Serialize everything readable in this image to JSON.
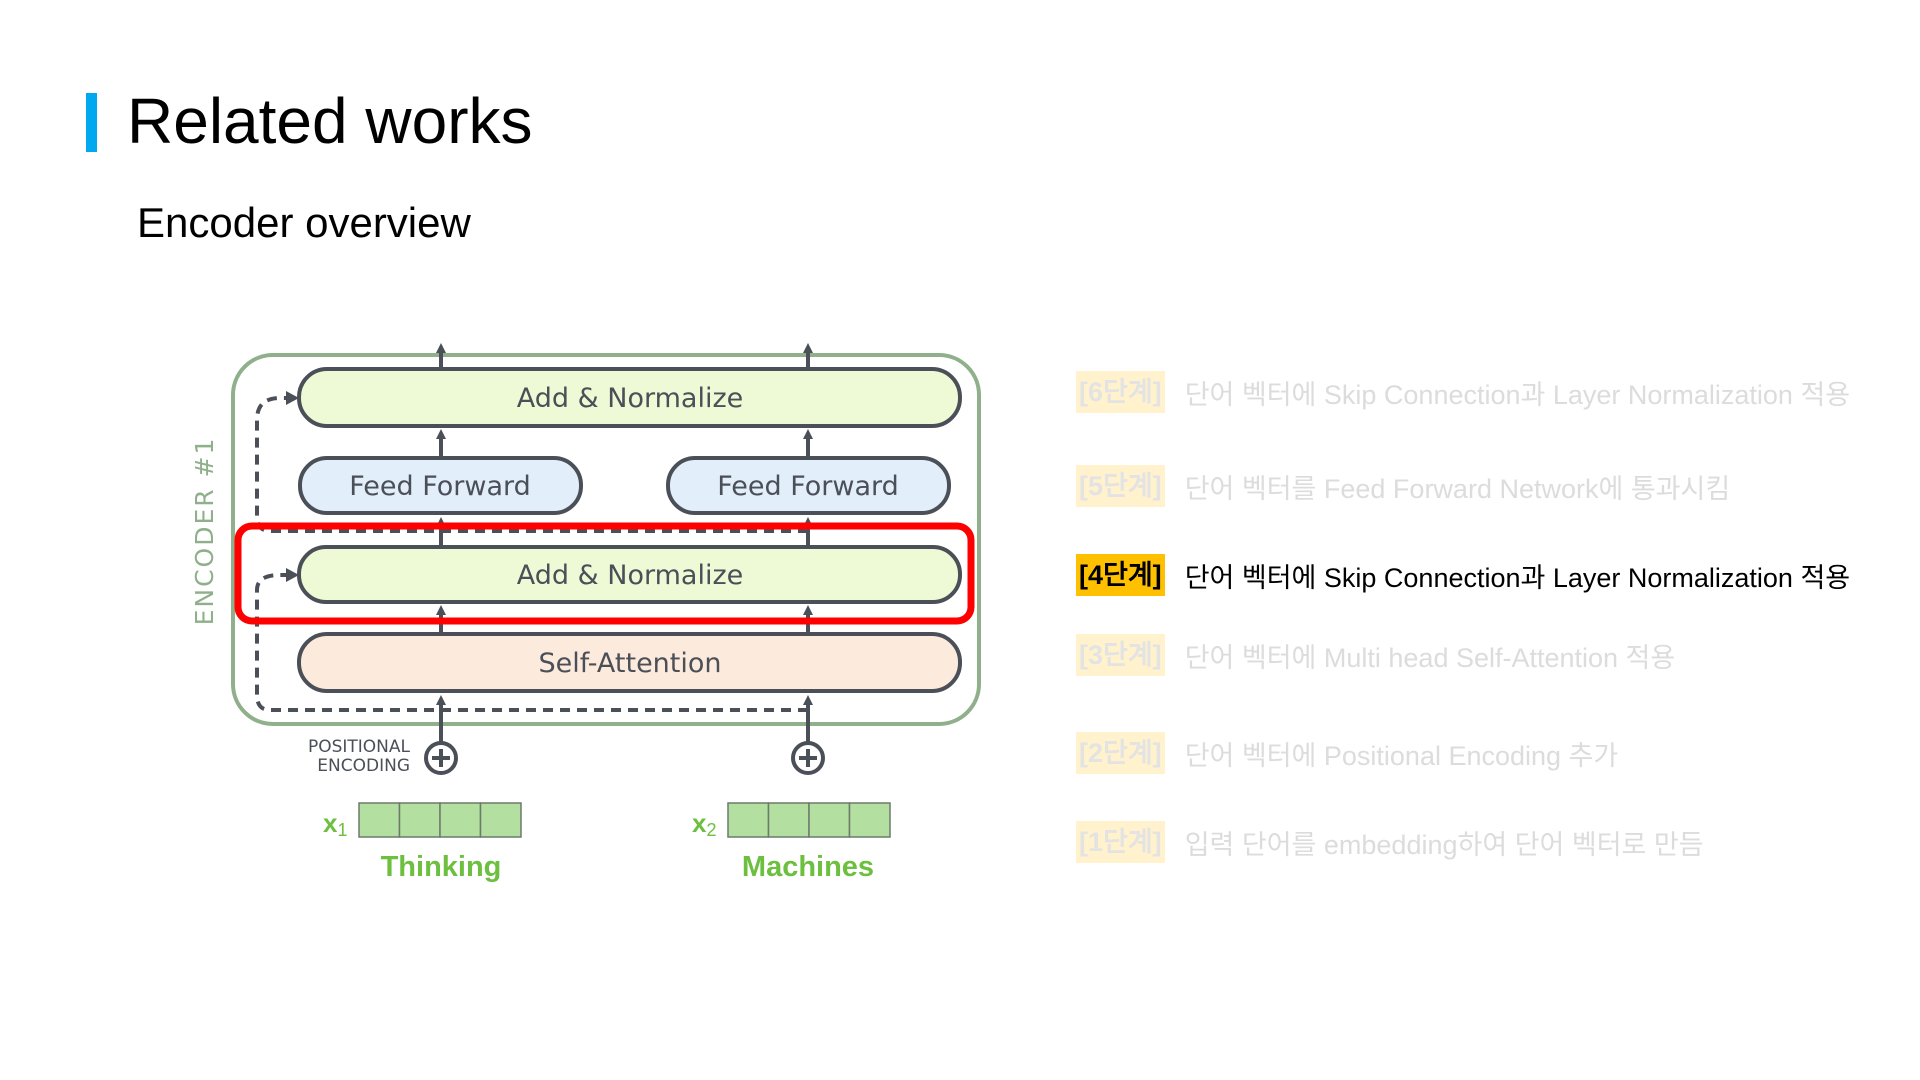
{
  "slide": {
    "title": "Related works",
    "subtitle": "Encoder overview",
    "accent_color": "#00a8f0"
  },
  "diagram": {
    "encoder_label": "ENCODER #1",
    "blocks": {
      "add_normalize_top": "Add & Normalize",
      "feed_forward_1": "Feed Forward",
      "feed_forward_2": "Feed Forward",
      "add_normalize_mid": "Add & Normalize",
      "self_attention": "Self-Attention"
    },
    "positional_encoding_line1": "POSITIONAL",
    "positional_encoding_line2": "ENCODING",
    "inputs": [
      {
        "var": "x",
        "sub": "1",
        "word": "Thinking",
        "cells": 4
      },
      {
        "var": "x",
        "sub": "2",
        "word": "Machines",
        "cells": 4
      }
    ],
    "highlight": "add_normalize_mid",
    "colors": {
      "add_normalize_fill": "#eefad6",
      "feed_forward_fill": "#e3eefb",
      "self_attention_fill": "#fcebdc",
      "block_stroke": "#4b4f57",
      "encoder_stroke": "#8fb08b",
      "highlight_stroke": "#ff0000",
      "embedding_fill": "#b3dfa0",
      "word_color": "#6cbf3f"
    }
  },
  "steps": [
    {
      "badge": "[6단계]",
      "text": "단어 벡터에 Skip Connection과 Layer Normalization 적용",
      "active": false
    },
    {
      "badge": "[5단계]",
      "text": "단어 벡터를 Feed Forward Network에 통과시킴",
      "active": false
    },
    {
      "badge": "[4단계]",
      "text": "단어 벡터에 Skip Connection과 Layer Normalization 적용",
      "active": true
    },
    {
      "badge": "[3단계]",
      "text": "단어 벡터에 Multi head Self-Attention 적용",
      "active": false
    },
    {
      "badge": "[2단계]",
      "text": "단어 벡터에 Positional Encoding 추가",
      "active": false
    },
    {
      "badge": "[1단계]",
      "text": "입력 단어를 embedding하여 단어 벡터로 만듬",
      "active": false
    }
  ]
}
